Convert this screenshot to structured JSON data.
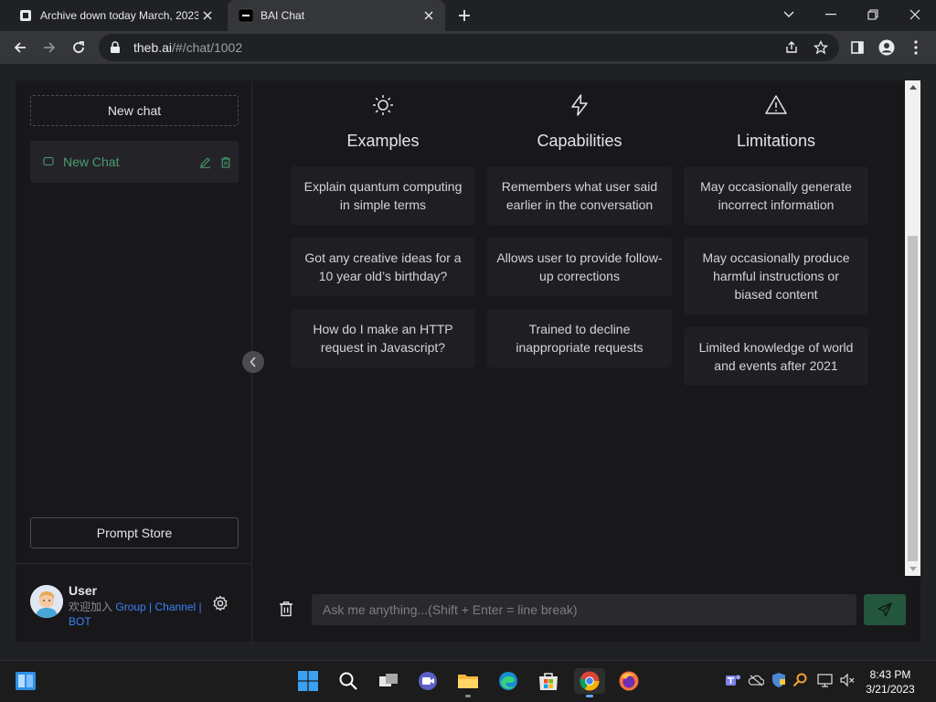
{
  "browser": {
    "tabs": [
      {
        "title": "Archive down today March, 2023",
        "active": false,
        "icon": "archive-favicon"
      },
      {
        "title": "BAI Chat",
        "active": true,
        "icon": "bai-favicon"
      }
    ],
    "url_host": "theb.ai",
    "url_path": "/#/chat/1002"
  },
  "sidebar": {
    "new_chat_label": "New chat",
    "chats": [
      {
        "label": "New Chat"
      }
    ],
    "prompt_store_label": "Prompt Store",
    "user": {
      "name": "User",
      "prefix": "欢迎加入",
      "link_group": "Group",
      "sep1": " | ",
      "link_channel": "Channel",
      "sep2": " |",
      "link_bot": "BOT"
    }
  },
  "main": {
    "columns": [
      {
        "title": "Examples",
        "icon": "sun-icon",
        "cards": [
          "Explain quantum computing in simple terms",
          "Got any creative ideas for a 10 year old’s birthday?",
          "How do I make an HTTP request in Javascript?"
        ]
      },
      {
        "title": "Capabilities",
        "icon": "lightning-icon",
        "cards": [
          "Remembers what user said earlier in the conversation",
          "Allows user to provide follow-up corrections",
          "Trained to decline inappropriate requests"
        ]
      },
      {
        "title": "Limitations",
        "icon": "warning-icon",
        "cards": [
          "May occasionally generate incorrect information",
          "May occasionally produce harmful instructions or biased content",
          "Limited knowledge of world and events after 2021"
        ]
      }
    ],
    "input_placeholder": "Ask me anything...(Shift + Enter = line break)"
  },
  "taskbar": {
    "time": "8:43 PM",
    "date": "3/21/2023"
  },
  "colors": {
    "accent_green": "#24563d",
    "chat_label_green": "#4a9a6f",
    "link_blue": "#3b82f6"
  }
}
